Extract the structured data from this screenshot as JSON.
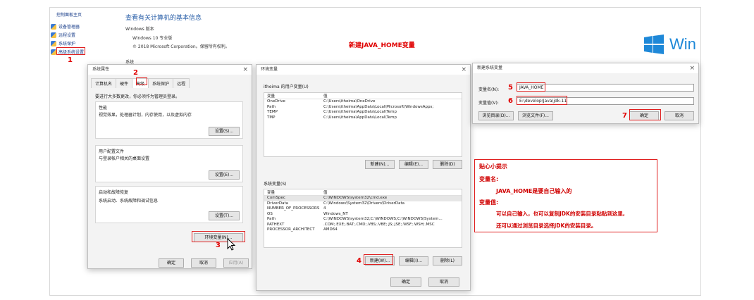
{
  "background": {
    "control_panel_home": "控制面板主页",
    "page_title": "查看有关计算机的基本信息",
    "windows_edition_label": "Windows 版本",
    "windows_version": "Windows 10 专业版",
    "copyright": "© 2018 Microsoft Corporation。保留所有权利。",
    "system_label": "系统",
    "windows_logo_text": "Win",
    "sidebar_items": [
      "设备管理器",
      "远程设置",
      "系统保护",
      "高级系统设置"
    ]
  },
  "annotation_heading": "新建JAVA_HOME变量",
  "steps": {
    "s1": "1",
    "s2": "2",
    "s3": "3",
    "s4": "4",
    "s5": "5",
    "s6": "6",
    "s7": "7"
  },
  "system_properties": {
    "title": "系统属性",
    "tabs": [
      "计算机名",
      "硬件",
      "高级",
      "系统保护",
      "远程"
    ],
    "admin_note": "要进行大多数更改，你必须作为管理员登录。",
    "performance": {
      "title": "性能",
      "desc": "视觉效果，处理器计划，内存使用，以及虚拟内存",
      "button": "设置(S)..."
    },
    "user_profiles": {
      "title": "用户配置文件",
      "desc": "与登录帐户相关的桌面设置",
      "button": "设置(E)..."
    },
    "startup": {
      "title": "启动和故障恢复",
      "desc": "系统启动、系统故障和调试信息",
      "button": "设置(T)..."
    },
    "env_button": "环境变量(N)...",
    "ok": "确定",
    "cancel": "取消",
    "apply": "应用(A)"
  },
  "env_vars": {
    "title": "环境变量",
    "user_section": "itheima 的用户变量(U)",
    "system_section": "系统变量(S)",
    "col_var": "变量",
    "col_val": "值",
    "user_rows": [
      {
        "name": "OneDrive",
        "value": "C:\\Users\\itheima\\OneDrive"
      },
      {
        "name": "Path",
        "value": "C:\\Users\\itheima\\AppData\\Local\\Microsoft\\WindowsApps;"
      },
      {
        "name": "TEMP",
        "value": "C:\\Users\\itheima\\AppData\\Local\\Temp"
      },
      {
        "name": "TMP",
        "value": "C:\\Users\\itheima\\AppData\\Local\\Temp"
      }
    ],
    "system_rows": [
      {
        "name": "ComSpec",
        "value": "C:\\WINDOWS\\system32\\cmd.exe"
      },
      {
        "name": "DriverData",
        "value": "C:\\Windows\\System32\\Drivers\\DriverData"
      },
      {
        "name": "NUMBER_OF_PROCESSORS",
        "value": "4"
      },
      {
        "name": "OS",
        "value": "Windows_NT"
      },
      {
        "name": "Path",
        "value": "C:\\WINDOWS\\system32;C:\\WINDOWS;C:\\WINDOWS\\System..."
      },
      {
        "name": "PATHEXT",
        "value": ".COM;.EXE;.BAT;.CMD;.VBS;.VBE;.JS;.JSE;.WSF;.WSH;.MSC"
      },
      {
        "name": "PROCESSOR_ARCHITECT",
        "value": "AMD64"
      }
    ],
    "user_buttons": [
      "新建(N)...",
      "编辑(E)...",
      "删除(D)"
    ],
    "system_buttons": [
      "新建(W)...",
      "编辑(I)...",
      "删除(L)"
    ],
    "ok": "确定",
    "cancel": "取消"
  },
  "new_var": {
    "title": "新建系统变量",
    "name_label": "变量名(N):",
    "name_value": "JAVA_HOME",
    "value_label": "变量值(V):",
    "value_value": "E:\\develop\\Java\\jdk-11",
    "browse_dir": "浏览目录(D)...",
    "browse_file": "浏览文件(F)...",
    "ok": "确定",
    "cancel": "取消"
  },
  "tip": {
    "heading": "贴心小提示",
    "name_label": "变量名:",
    "name_text": "JAVA_HOME是要自己输入的",
    "value_label": "变量值:",
    "value_text_1": "可以自己输入，也可以复制JDK的安装目录粘贴到这里,",
    "value_text_2": "还可以通过浏览目录选择JDK的安装目录。"
  },
  "colors": {
    "annotation_red": "#e00000",
    "link_blue": "#1a3e8a",
    "windows_blue": "#1e88d8"
  }
}
